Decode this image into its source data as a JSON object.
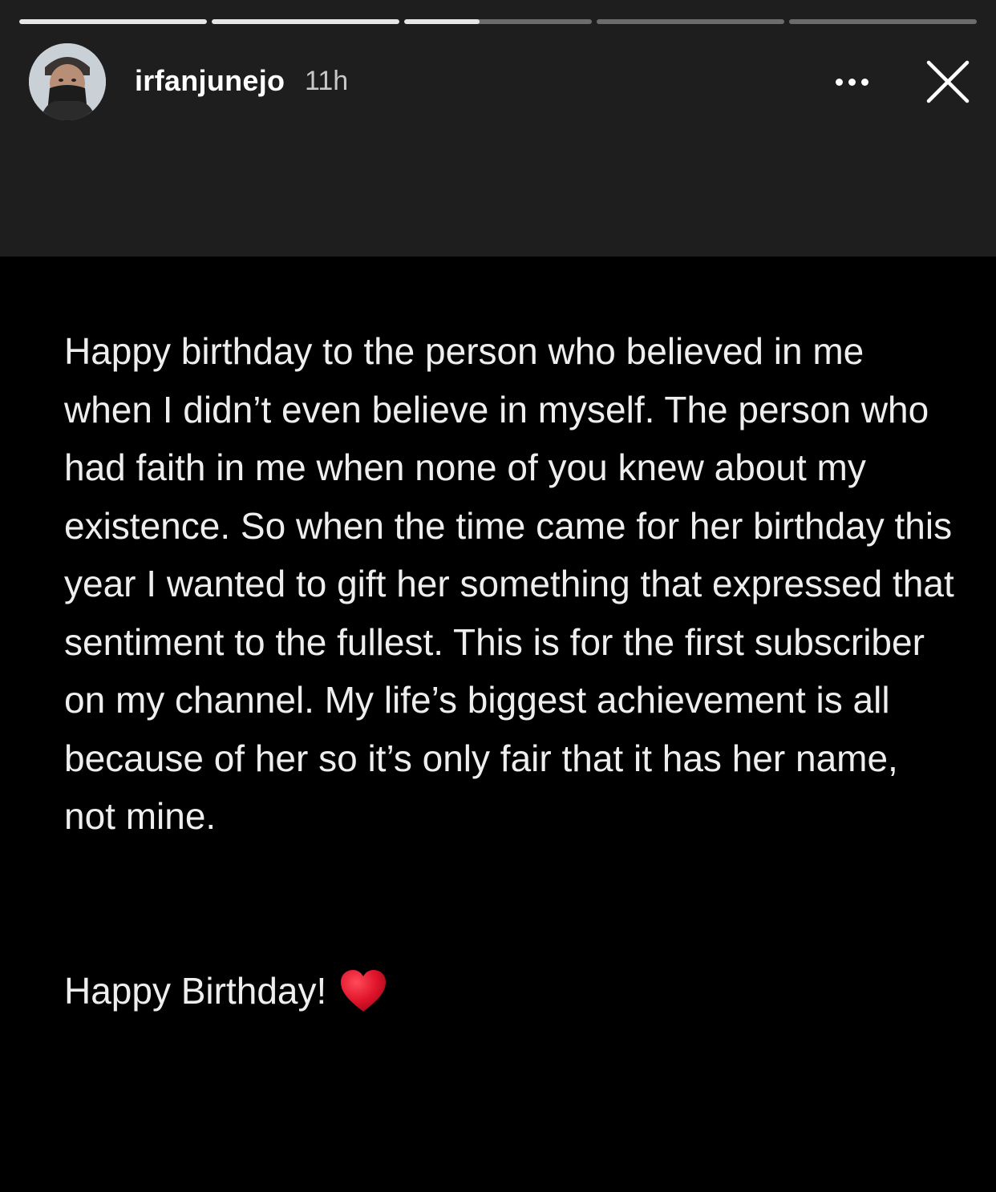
{
  "story": {
    "progress_segments": [
      1,
      1,
      0.4,
      0,
      0
    ],
    "user": {
      "username": "irfanjunejo",
      "timestamp": "11h",
      "avatar_icon": "profile-avatar"
    },
    "actions": {
      "more_icon": "more-horizontal-icon",
      "close_icon": "close-icon"
    },
    "body": {
      "message": "Happy birthday to the person who believed in me when I didn’t even believe in myself. The person who had faith in me when none of you knew about my existence. So when the time came for her birthday this year I wanted to gift her something that expressed that sentiment to the fullest. This is for the first subscriber on my channel. My life’s biggest achievement is all because of her so it’s only fair that it has her name, not mine.",
      "closing": "Happy Birthday!",
      "closing_icon": "red-heart-icon"
    }
  },
  "colors": {
    "header_bg": "#1e1e1e",
    "content_bg": "#000000",
    "text": "#eeeeee",
    "heart": "#e0142b"
  }
}
